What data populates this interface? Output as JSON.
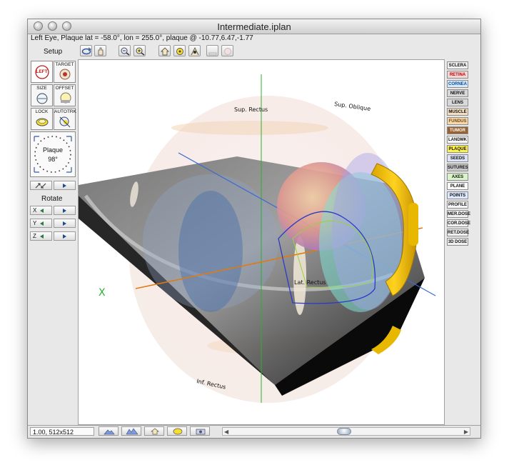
{
  "window": {
    "title": "Intermediate.iplan",
    "status": "Left Eye, Plaque lat = -58.0°, lon = 255.0°, plaque @ -10.77,6.47,-1.77"
  },
  "left_panel": {
    "setup_label": "Setup",
    "eye_button": "LEFT",
    "target_label": "TARGET",
    "size_label": "SIZE",
    "offset_label": "OFFSET",
    "lock_label": "LOCK",
    "autotrk_label": "AUTOTRK",
    "dial_name": "Plaque",
    "dial_value": "98°",
    "rotate_label": "Rotate",
    "axes": [
      "X",
      "Y",
      "Z"
    ]
  },
  "layers": [
    {
      "label": "SCLERA",
      "color": "#f0f0f0"
    },
    {
      "label": "RETINA",
      "color": "#f6d7d7",
      "text_color": "#b00000"
    },
    {
      "label": "CORNEA",
      "color": "#d8e8f8",
      "text_color": "#0050a0"
    },
    {
      "label": "NERVE",
      "color": "#d8d8d8"
    },
    {
      "label": "LENS",
      "color": "#d8d8d8"
    },
    {
      "label": "MUSCLE",
      "color": "#f3e0c2"
    },
    {
      "label": "FUNDUS",
      "color": "#f3d8b0",
      "text_color": "#7a4a00"
    },
    {
      "label": "TUMOR",
      "color": "#9a6230",
      "text_color": "#ffffff"
    },
    {
      "label": "LANDMK",
      "color": "#f8f8f8"
    },
    {
      "label": "PLAQUE",
      "color": "#fff24a"
    },
    {
      "label": "SEEDS",
      "color": "#dbe3f8"
    },
    {
      "label": "SUTURES",
      "color": "#c9c9c9"
    },
    {
      "label": "AXES",
      "color": "#d8f4c8"
    },
    {
      "label": "PLANE",
      "color": "#f8f8f8"
    },
    {
      "label": "POINTS",
      "color": "#dbe8ff"
    },
    {
      "label": "PROFILE",
      "color": "#f8f8f8"
    },
    {
      "label": "MER.DOSE",
      "color": "#f0f0f0"
    },
    {
      "label": "COR.DOSE",
      "color": "#f0f0f0"
    },
    {
      "label": "RET.DOSE",
      "color": "#f0f0f0"
    },
    {
      "label": "3D DOSE",
      "color": "#f0f0f0"
    }
  ],
  "canvas_labels": {
    "sup_rectus": "Sup. Rectus",
    "sup_oblique": "Sup. Oblique",
    "lat_rectus": "Lat. Rectus",
    "inf_rectus": "Inf. Rectus",
    "axis_x": "X"
  },
  "bottom": {
    "zoom_readout": "1.00, 512x512"
  },
  "colors": {
    "plaque": "#f2c400",
    "tumor_teal": "#7fe0d4",
    "axis_green": "#2bb030",
    "axis_orange": "#e07a10",
    "axis_blue": "#3a6ad0"
  }
}
